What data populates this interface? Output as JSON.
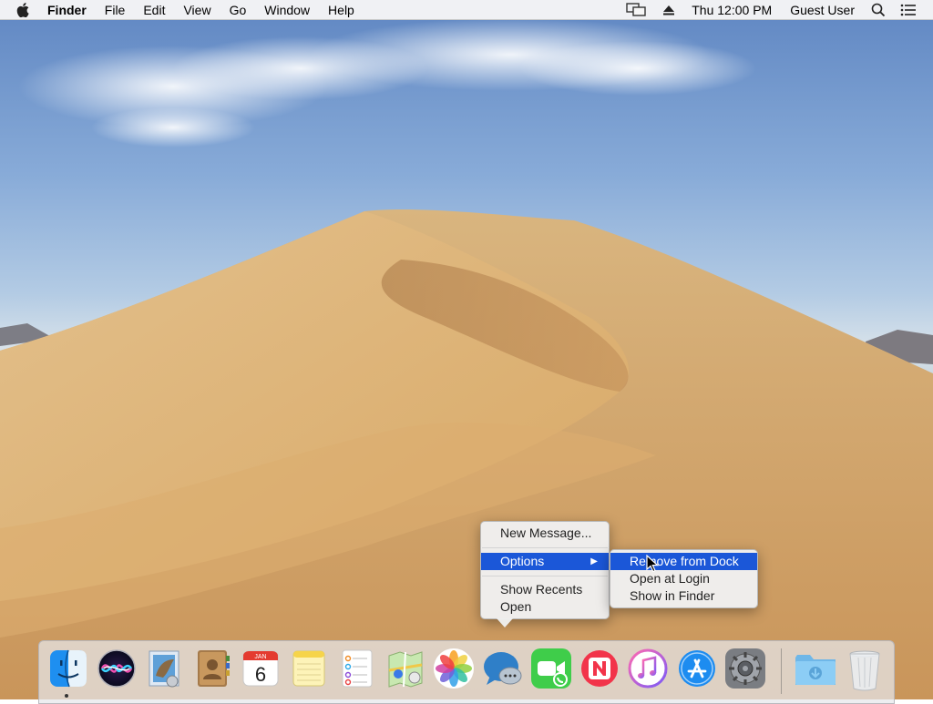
{
  "menubar": {
    "app_name": "Finder",
    "menus": [
      "File",
      "Edit",
      "View",
      "Go",
      "Window",
      "Help"
    ],
    "clock": "Thu 12:00 PM",
    "user": "Guest User",
    "icons": [
      "apple-icon",
      "display-mirroring-icon",
      "eject-icon",
      "spotlight-icon",
      "notification-center-icon"
    ]
  },
  "context_menu": {
    "items": [
      "New Message...",
      "Options",
      "Show Recents",
      "Open"
    ]
  },
  "submenu": {
    "items": [
      "Remove from Dock",
      "Open at Login",
      "Show in Finder"
    ]
  },
  "dock": {
    "apps": [
      "finder",
      "siri",
      "mail",
      "contacts",
      "calendar",
      "notes",
      "reminders",
      "maps",
      "photos",
      "messages",
      "facetime",
      "news",
      "itunes",
      "app-store",
      "system-preferences",
      "downloads",
      "trash"
    ],
    "calendar": {
      "month": "JAN",
      "day": "6"
    }
  },
  "colors": {
    "highlight": "#1b57d8",
    "menu_bg": "#f0f0f0",
    "sand": "#d9b47e"
  }
}
